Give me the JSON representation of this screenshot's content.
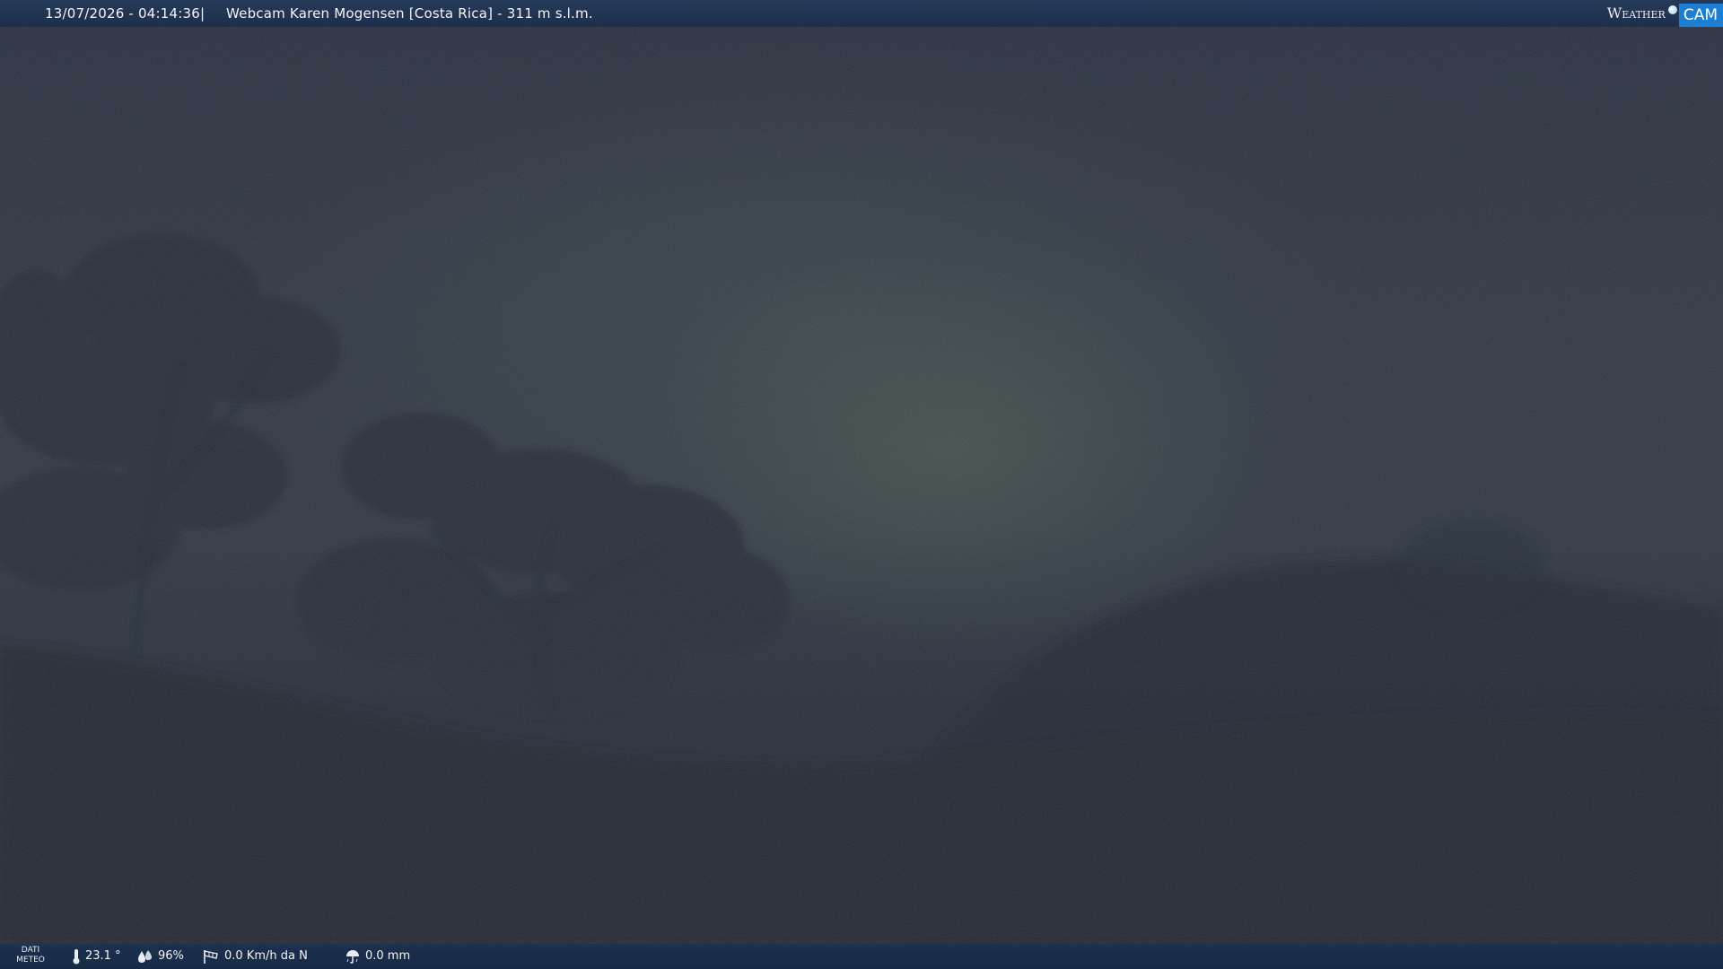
{
  "header": {
    "timestamp": "13/07/2026 - 04:14:36",
    "separator": "|",
    "title": "Webcam Karen Mogensen [Costa Rica] - 311 m s.l.m.",
    "brand": {
      "left": "Weather",
      "right": "CAM",
      "accent_color": "#1d7fd4"
    }
  },
  "footer": {
    "label_line1": "DATI",
    "label_line2": "METEO",
    "temperature": "23.1 °",
    "humidity": "96%",
    "wind": "0.0 Km/h da N",
    "rain": "0.0 mm",
    "icons": {
      "temperature": "thermometer-icon",
      "humidity": "humidity-drops-icon",
      "wind": "wind-sock-icon",
      "rain": "rain-umbrella-icon"
    }
  },
  "colors": {
    "bar_background": "#1d2f4c",
    "sky": "#2d3440"
  }
}
